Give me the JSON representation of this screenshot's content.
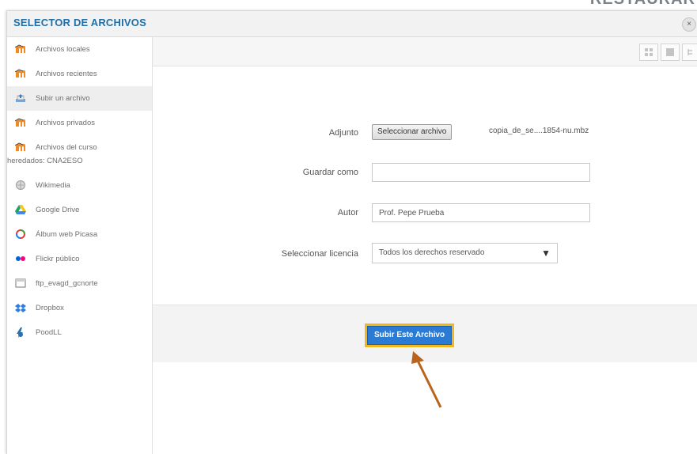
{
  "background": {
    "heading_fragment": "RESTAURAR"
  },
  "dialog": {
    "title": "SELECTOR DE ARCHIVOS",
    "close_symbol": "×"
  },
  "sidebar": {
    "items": [
      {
        "label": "Archivos locales",
        "icon": "moodle-icon"
      },
      {
        "label": "Archivos recientes",
        "icon": "moodle-icon"
      },
      {
        "label": "Subir un archivo",
        "icon": "upload-icon",
        "active": true
      },
      {
        "label": "Archivos privados",
        "icon": "moodle-icon"
      },
      {
        "label": "Archivos del curso",
        "label2": "heredados: CNA2ESO",
        "icon": "moodle-icon"
      },
      {
        "label": "Wikimedia",
        "icon": "wikimedia-icon"
      },
      {
        "label": "Google Drive",
        "icon": "google-drive-icon"
      },
      {
        "label": "Álbum web Picasa",
        "icon": "picasa-icon"
      },
      {
        "label": "Flickr público",
        "icon": "flickr-icon"
      },
      {
        "label": "ftp_evagd_gcnorte",
        "icon": "ftp-icon"
      },
      {
        "label": "Dropbox",
        "icon": "dropbox-icon"
      },
      {
        "label": "PoodLL",
        "icon": "poodll-icon"
      }
    ]
  },
  "form": {
    "attachment_label": "Adjunto",
    "choose_file_label": "Seleccionar archivo",
    "chosen_file_name": "copia_de_se....1854-nu.mbz",
    "save_as_label": "Guardar como",
    "save_as_value": "",
    "author_label": "Autor",
    "author_value": "Prof. Pepe Prueba",
    "license_label": "Seleccionar licencia",
    "license_value": "Todos los derechos reservado",
    "license_caret": "▼"
  },
  "footer": {
    "submit_label": "Subir Este Archivo"
  },
  "colors": {
    "title": "#1f6fa8",
    "submit": "#2b7bd4",
    "highlight": "#f3b71c",
    "arrow": "#b8641f"
  }
}
